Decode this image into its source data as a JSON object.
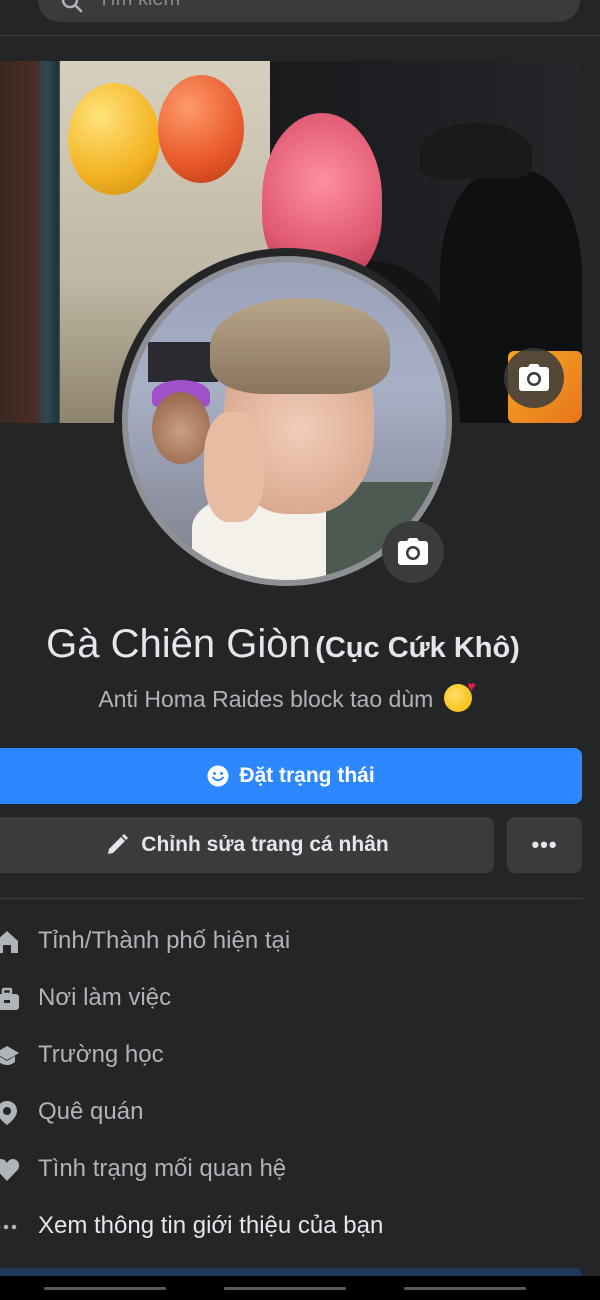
{
  "search": {
    "placeholder": "Tìm kiếm"
  },
  "profile": {
    "name": "Gà Chiên Giòn",
    "alternate_name": "(Cục Cứk Khô)",
    "bio": "Anti Homa Raides block tao dùm"
  },
  "actions": {
    "status_button": "Đặt trạng thái",
    "edit_button": "Chỉnh sửa trang cá nhân",
    "more_button": "•••"
  },
  "info": [
    {
      "icon": "house-icon",
      "label": "Tỉnh/Thành phố hiện tại"
    },
    {
      "icon": "briefcase-icon",
      "label": "Nơi làm việc"
    },
    {
      "icon": "graduation-cap-icon",
      "label": "Trường học"
    },
    {
      "icon": "location-pin-icon",
      "label": "Quê quán"
    },
    {
      "icon": "heart-icon",
      "label": "Tình trạng mối quan hệ"
    },
    {
      "icon": "more-dots-icon",
      "label": "Xem thông tin giới thiệu của bạn"
    }
  ],
  "colors": {
    "background": "#242526",
    "primary_button": "#2d88ff",
    "secondary_button": "#3a3b3c",
    "text_primary": "#e4e6eb",
    "text_secondary": "#b0b3b8"
  }
}
